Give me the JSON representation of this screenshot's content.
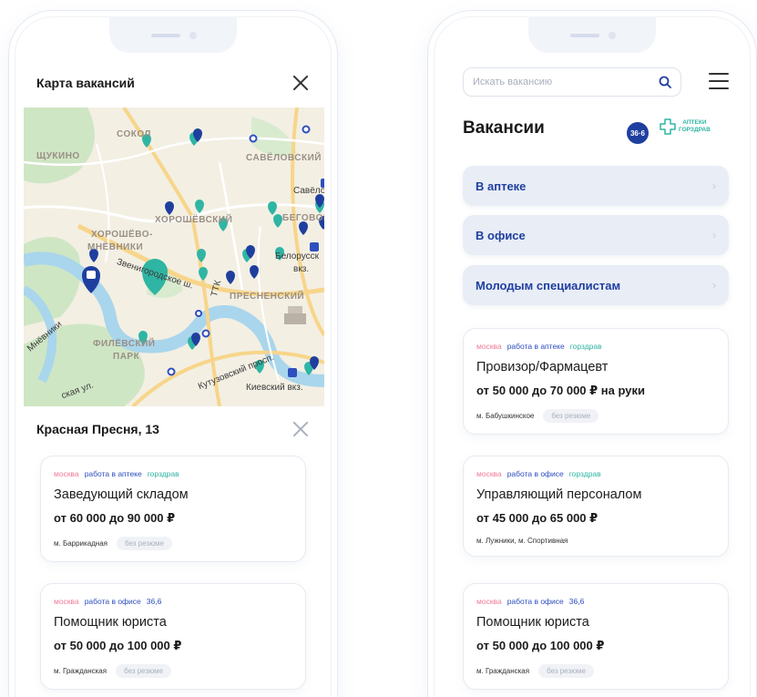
{
  "left": {
    "header": {
      "title": "Карта вакансий"
    },
    "map": {
      "labels": {
        "sokol": "СОКОЛ",
        "shchukino": "ЩУКИНО",
        "savelovsky": "САВЁЛОВСКИЙ",
        "savelo": "Савёло",
        "khoroshevsky": "ХОРОШЁВСКИЙ",
        "begovoy": "БЕГОВОЙ",
        "khoroshevo": "ХОРОШЁВО-",
        "mnevniki": "МНЁВНИКИ",
        "zvenigorodskoe": "Звенигородское ш.",
        "belorussky": "Белорусск",
        "vkz": "вкз.",
        "ttk": "ТТК",
        "presnensky": "ПРЕСНЕНСКИЙ",
        "filevsky": "ФИЛЁВСКИЙ",
        "park": "ПАРК",
        "kutuzovsky": "Кутузовский просп.",
        "kievsky": "Киевский вкз.",
        "mnevniki_street": "Мнёвники",
        "street_ul": "ская ул."
      }
    },
    "address": "Красная Пресня, 13",
    "cards": [
      {
        "city": "москва",
        "type": "работа в аптеке",
        "brand": "горздрав",
        "title": "Заведующий складом",
        "salary": "от 60 000 до 90 000 ₽",
        "metro": "м. Баррикадная",
        "resume": "без резюме"
      },
      {
        "city": "москва",
        "type": "работа в офисе",
        "brand": "36,6",
        "title": "Помощник юриста",
        "salary": "от 50 000 до 100 000 ₽",
        "metro": "м. Гражданская",
        "resume": "без резюме"
      }
    ]
  },
  "right": {
    "search": {
      "placeholder": "Искать вакансию"
    },
    "title": "Вакансии",
    "logos": {
      "badge": "36·6",
      "gz_line1": "АПТЕКИ",
      "gz_line2": "ГОРЗДРАВ"
    },
    "categories": [
      "В аптеке",
      "В офисе",
      "Молодым специалистам"
    ],
    "cards": [
      {
        "city": "москва",
        "type": "работа в аптеке",
        "brand": "горздрав",
        "title": "Провизор/Фармацевт",
        "salary": "от 50 000 до 70 000 ₽ на руки",
        "metro": "м. Бабушкинское",
        "resume": "без резюме"
      },
      {
        "city": "москва",
        "type": "работа в офисе",
        "brand": "горздрав",
        "title": "Управляющий персоналом",
        "salary": "от 45 000 до 65 000 ₽",
        "metro": "м. Лужники, м. Спортивная",
        "resume": ""
      },
      {
        "city": "москва",
        "type": "работа в офисе",
        "brand": "36,6",
        "title": "Помощник юриста",
        "salary": "от 50 000 до 100 000 ₽",
        "metro": "м. Гражданская",
        "resume": "без резюме"
      }
    ]
  },
  "colors": {
    "accent_blue": "#1f3f9f",
    "accent_teal": "#2fb5a3",
    "tag_pink": "#f07a99",
    "pin_navy": "#1f3f9f"
  }
}
